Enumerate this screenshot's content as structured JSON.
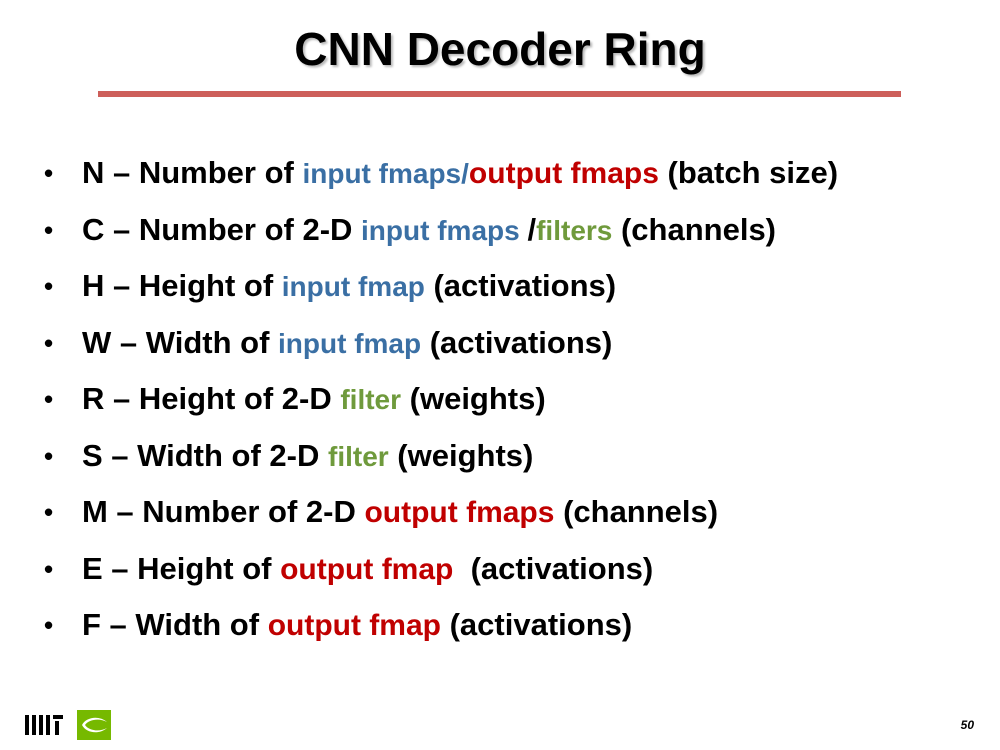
{
  "slide": {
    "title": "CNN Decoder Ring",
    "page_number": "50",
    "colors": {
      "title_rule": "#cd5f5a",
      "input": "#3a6fa4",
      "output": "#c00000",
      "filter": "#6f9a3c",
      "nvidia_green": "#76b900"
    },
    "logos": [
      "mit-logo",
      "nvidia-logo"
    ]
  },
  "bullets": [
    {
      "segments": [
        {
          "text": "N – Number of ",
          "style": "plain"
        },
        {
          "text": "input fmaps/",
          "style": "input"
        },
        {
          "text": "output fmaps",
          "style": "output"
        },
        {
          "text": " (batch size)",
          "style": "plain"
        }
      ]
    },
    {
      "segments": [
        {
          "text": "C – Number of 2-D ",
          "style": "plain"
        },
        {
          "text": "input fmaps ",
          "style": "input"
        },
        {
          "text": "/",
          "style": "plain"
        },
        {
          "text": "filters",
          "style": "filter"
        },
        {
          "text": " (channels)",
          "style": "plain"
        }
      ]
    },
    {
      "segments": [
        {
          "text": "H – Height of ",
          "style": "plain"
        },
        {
          "text": "input fmap",
          "style": "input"
        },
        {
          "text": " (activations)",
          "style": "plain"
        }
      ]
    },
    {
      "segments": [
        {
          "text": "W – Width of ",
          "style": "plain"
        },
        {
          "text": "input fmap",
          "style": "input"
        },
        {
          "text": " (activations)",
          "style": "plain"
        }
      ]
    },
    {
      "segments": [
        {
          "text": "R – Height of 2-D ",
          "style": "plain"
        },
        {
          "text": "filter",
          "style": "filter"
        },
        {
          "text": " (weights)",
          "style": "plain"
        }
      ]
    },
    {
      "segments": [
        {
          "text": "S – Width of 2-D ",
          "style": "plain"
        },
        {
          "text": "filter",
          "style": "filter"
        },
        {
          "text": " (weights)",
          "style": "plain"
        }
      ]
    },
    {
      "segments": [
        {
          "text": "M – Number of 2-D ",
          "style": "plain"
        },
        {
          "text": "output fmaps",
          "style": "output"
        },
        {
          "text": " (channels)",
          "style": "plain"
        }
      ]
    },
    {
      "segments": [
        {
          "text": "E – Height of ",
          "style": "plain"
        },
        {
          "text": "output fmap",
          "style": "output"
        },
        {
          "text": "  (activations)",
          "style": "plain"
        }
      ]
    },
    {
      "segments": [
        {
          "text": "F – Width of ",
          "style": "plain"
        },
        {
          "text": "output fmap",
          "style": "output"
        },
        {
          "text": " (activations)",
          "style": "plain"
        }
      ]
    }
  ]
}
